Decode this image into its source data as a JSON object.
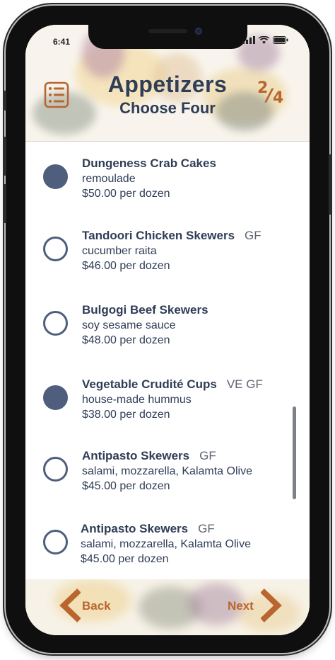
{
  "status": {
    "time": "6:41"
  },
  "header": {
    "title": "Appetizers",
    "subtitle": "Choose Four",
    "progress": {
      "current": "2",
      "total": "4"
    }
  },
  "items": [
    {
      "name": "Dungeness Crab Cakes",
      "tags": "",
      "description": "remoulade",
      "price": "$50.00 per dozen",
      "selected": true
    },
    {
      "name": "Tandoori Chicken Skewers",
      "tags": "GF",
      "description": "cucumber raita",
      "price": "$46.00 per dozen",
      "selected": false
    },
    {
      "name": "Bulgogi Beef Skewers",
      "tags": "",
      "description": "soy sesame sauce",
      "price": "$48.00 per dozen",
      "selected": false
    },
    {
      "name": "Vegetable Crudité Cups",
      "tags": "VE GF",
      "description": "house-made hummus",
      "price": "$38.00 per dozen",
      "selected": true
    },
    {
      "name": "Antipasto Skewers",
      "tags": "GF",
      "description": "salami, mozzarella, Kalamta Olive",
      "price": "$45.00 per dozen",
      "selected": false
    },
    {
      "name": "Antipasto Skewers",
      "tags": "GF",
      "description": "salami, mozzarella, Kalamta Olive",
      "price": "$45.00 per dozen",
      "selected": false
    }
  ],
  "footer": {
    "back_label": "Back",
    "next_label": "Next"
  },
  "colors": {
    "navy": "#2f3d57",
    "radio": "#4e5e7c",
    "accent": "#b9652f"
  }
}
